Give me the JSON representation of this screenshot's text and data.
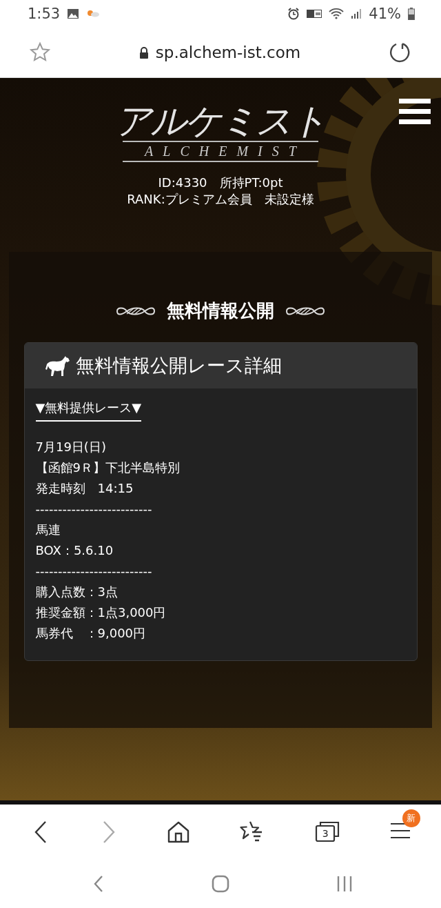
{
  "status_bar": {
    "time": "1:53",
    "battery": "41%"
  },
  "address_bar": {
    "url": "sp.alchem-ist.com"
  },
  "header": {
    "logo": "アルケミスト",
    "logo_sub": "ALCHEMIST",
    "user_lines": [
      "ID:4330　所持PT:0pt",
      "RANK:プレミアム会員　未設定様"
    ]
  },
  "section": {
    "title": "無料情報公開",
    "card": {
      "title": "無料情報公開レース詳細",
      "subtitle": "▼無料提供レース▼",
      "lines": [
        "7月19日(日)",
        "【函館9Ｒ】下北半島特別",
        "発走時刻　14:15",
        "--------------------------",
        "馬連",
        "BOX：5.6.10",
        "--------------------------",
        "購入点数：3点",
        "推奨金額：1点3,000円",
        "馬券代　：9,000円"
      ]
    }
  },
  "toolbar": {
    "forward_disabled": true,
    "tab_count": "3",
    "menu_badge": "新"
  }
}
